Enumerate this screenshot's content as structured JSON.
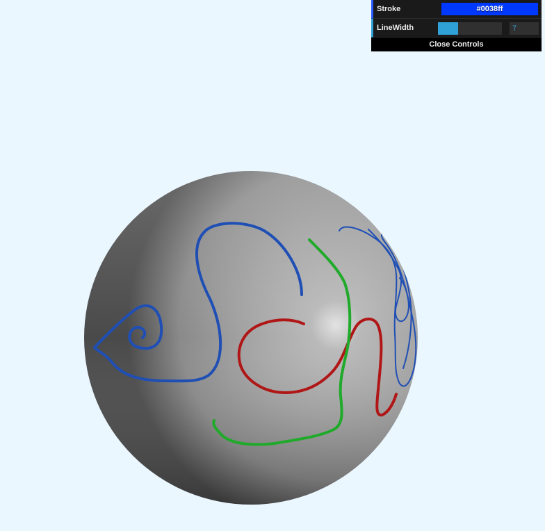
{
  "controls": {
    "stroke_label": "Stroke",
    "stroke_value": "#0038ff",
    "stroke_color": "#0038ff",
    "linewidth_label": "LineWidth",
    "linewidth_value": "7",
    "linewidth_fraction": 0.31,
    "close_label": "Close Controls"
  },
  "colors": {
    "background": "#eaf7ff",
    "blue_stroke": "#1f4fb4",
    "green_stroke": "#1faa2a",
    "red_stroke": "#b01616"
  }
}
